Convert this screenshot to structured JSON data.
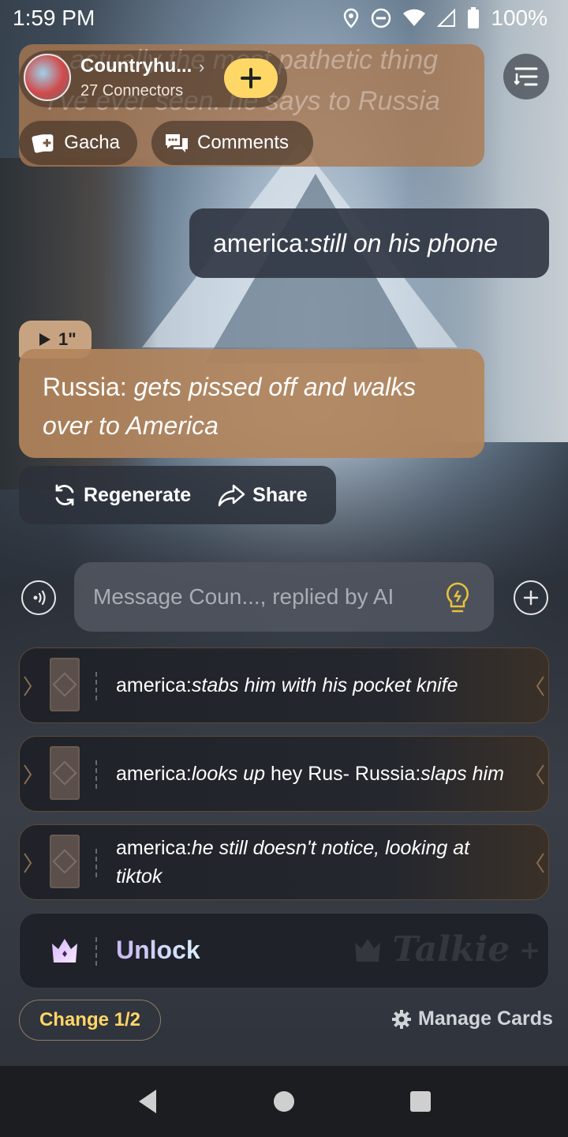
{
  "status_bar": {
    "time": "1:59 PM",
    "battery": "100%",
    "icons": [
      "location-icon",
      "dnd-icon",
      "wifi-icon",
      "signal-icon",
      "battery-icon"
    ]
  },
  "header": {
    "ghost_text": "e actually the most pathetic thing I've ever seen. he says to Russia",
    "title": "Countryhu...",
    "subtitle": "27 Connectors",
    "gacha_label": "Gacha",
    "comments_label": "Comments"
  },
  "messages": {
    "right_speaker": "america:",
    "right_action": "still on his phone",
    "audio_duration": "1\"",
    "left_speaker": "Russia: ",
    "left_action": "gets pissed off and walks over to America"
  },
  "actions": {
    "regenerate": "Regenerate",
    "share": "Share"
  },
  "composer": {
    "placeholder": "Message Coun..., replied by AI"
  },
  "suggestions": [
    {
      "speaker": "america:",
      "italic": "stabs him with his pocket knife",
      "rest": ""
    },
    {
      "speaker": "america:",
      "italic": "looks up",
      "mid": " hey Rus- Russia:",
      "italic2": "slaps him"
    },
    {
      "speaker": "america:",
      "italic": "he still doesn't notice, looking at tiktok",
      "rest": ""
    }
  ],
  "unlock": {
    "label": "Unlock",
    "brand": "Talkie"
  },
  "footer": {
    "change_label": "Change 1/2",
    "manage_label": "Manage Cards"
  },
  "colors": {
    "accent_yellow": "#ffd766",
    "bubble_brown": "#b2845c",
    "bubble_dark": "#323744"
  }
}
